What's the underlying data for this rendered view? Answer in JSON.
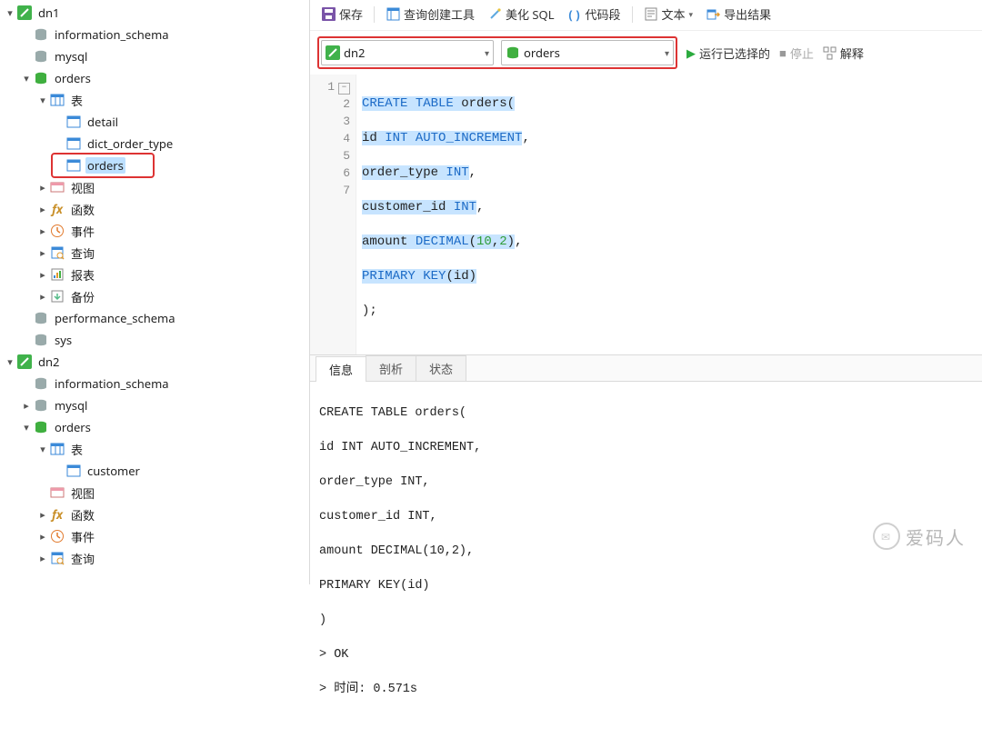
{
  "tree": {
    "dn1": "dn1",
    "information_schema": "information_schema",
    "mysql": "mysql",
    "orders": "orders",
    "tables": "表",
    "detail": "detail",
    "dict_order_type": "dict_order_type",
    "orders_table": "orders",
    "views": "视图",
    "functions": "函数",
    "events": "事件",
    "queries": "查询",
    "reports": "报表",
    "backup": "备份",
    "performance_schema": "performance_schema",
    "sys": "sys",
    "dn2": "dn2",
    "customer": "customer"
  },
  "toolbar": {
    "save": "保存",
    "query_builder": "查询创建工具",
    "beautify": "美化 SQL",
    "snippet": "代码段",
    "text": "文本",
    "export": "导出结果"
  },
  "runbar": {
    "conn": "dn2",
    "target": "orders",
    "run": "运行已选择的",
    "stop": "停止",
    "explain": "解释"
  },
  "code": {
    "l1a": "CREATE",
    "l1b": "TABLE",
    "l1c": " orders(",
    "l2a": "id ",
    "l2b": "INT",
    "l2c": " AUTO_INCREMENT",
    "l2d": ",",
    "l3a": "order_type ",
    "l3b": "INT",
    "l3c": ",",
    "l4a": "customer_id ",
    "l4b": "INT",
    "l4c": ",",
    "l5a": "amount ",
    "l5b": "DECIMAL",
    "l5c": "(",
    "l5d": "10",
    "l5e": ",",
    "l5f": "2",
    "l5g": ")",
    "l5h": ",",
    "l6a": "PRIMARY",
    "l6b": "KEY",
    "l6c": "(id)",
    "l7a": ");",
    "n1": "1",
    "n2": "2",
    "n3": "3",
    "n4": "4",
    "n5": "5",
    "n6": "6",
    "n7": "7"
  },
  "tabs": {
    "info": "信息",
    "profile": "剖析",
    "status": "状态"
  },
  "output": {
    "l1": "CREATE TABLE orders(",
    "l2": "id INT AUTO_INCREMENT,",
    "l3": "order_type INT,",
    "l4": "customer_id INT,",
    "l5": "amount DECIMAL(10,2),",
    "l6": "PRIMARY KEY(id)",
    "l7": ")",
    "l8": "> OK",
    "l9": "> 时间: 0.571s"
  },
  "watermark": {
    "text": "爱码人"
  }
}
